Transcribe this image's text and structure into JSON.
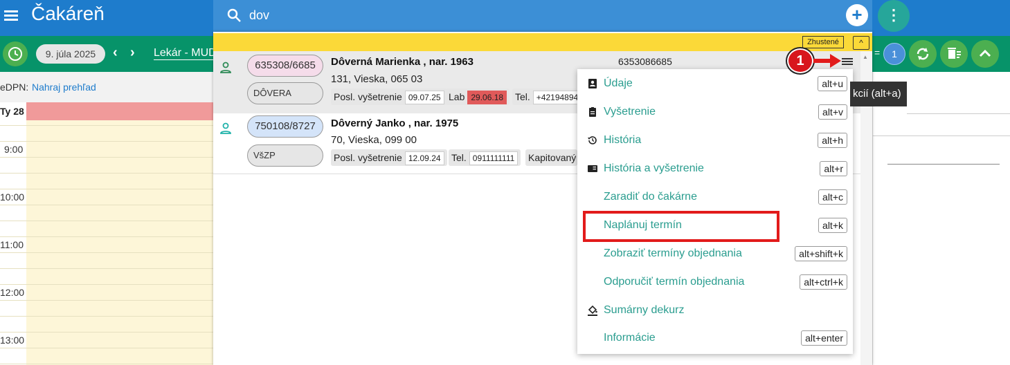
{
  "app": {
    "title": "Čakáreň"
  },
  "search": {
    "value": "dov"
  },
  "toolbar": {
    "date": "9. júla 2025",
    "prev": "‹",
    "next": "›",
    "doctor": "Lekár - MUD",
    "count_prefix": "=",
    "count": "1"
  },
  "edpn": {
    "label": "eDPN:",
    "link": "Nahraj prehľad"
  },
  "calendar": {
    "day_header": "Ty 28",
    "times": [
      "9:00",
      "10:00",
      "11:00",
      "12:00",
      "13:00"
    ]
  },
  "list": {
    "dense_badge": "Zhustené",
    "collapse": "^",
    "patients": [
      {
        "rc": "635308/6685",
        "insurance": "DÔVERA",
        "name": "Dôverná Marienka , nar. 1963",
        "address": "131, Vieska, 065 03",
        "phone": "6353086685",
        "last_exam_label": "Posl. vyšetrenie",
        "last_exam": "09.07.25",
        "lab_label": "Lab",
        "lab": "29.06.18",
        "tel_label": "Tel.",
        "tel": "+42194894"
      },
      {
        "rc": "750108/8727",
        "insurance": "VšZP",
        "name": "Dôverný Janko , nar. 1975",
        "address": "70, Vieska, 099 00",
        "last_exam_label": "Posl. vyšetrenie",
        "last_exam": "12.09.24",
        "tel_label": "Tel.",
        "tel": "0911111111",
        "capitation": "Kapitovaný"
      }
    ]
  },
  "annotation": {
    "step": "1"
  },
  "tooltip": {
    "text": "kcií (alt+a)"
  },
  "context_menu": {
    "items": [
      {
        "label": "Údaje",
        "shortcut": "alt+u",
        "icon": "contact-card-icon"
      },
      {
        "label": "Vyšetrenie",
        "shortcut": "alt+v",
        "icon": "clipboard-icon"
      },
      {
        "label": "História",
        "shortcut": "alt+h",
        "icon": "history-icon"
      },
      {
        "label": "História a vyšetrenie",
        "shortcut": "alt+r",
        "icon": "book-icon"
      },
      {
        "label": "Zaradiť do čakárne",
        "shortcut": "alt+c",
        "icon": ""
      },
      {
        "label": "Naplánuj termín",
        "shortcut": "alt+k",
        "icon": ""
      },
      {
        "label": "Zobraziť termíny objednania",
        "shortcut": "alt+shift+k",
        "icon": ""
      },
      {
        "label": "Odporučiť termín objednania",
        "shortcut": "alt+ctrl+k",
        "icon": ""
      },
      {
        "label": "Sumárny dekurz",
        "shortcut": "",
        "icon": "paint-bucket-icon"
      },
      {
        "label": "Informácie",
        "shortcut": "alt+enter",
        "icon": ""
      }
    ]
  },
  "colors": {
    "topbar": "#1e7ccc",
    "greenbar": "#079369",
    "menu_text": "#2a9d8f",
    "highlight": "#e21b1b",
    "yellow_bar": "#fbd938"
  }
}
